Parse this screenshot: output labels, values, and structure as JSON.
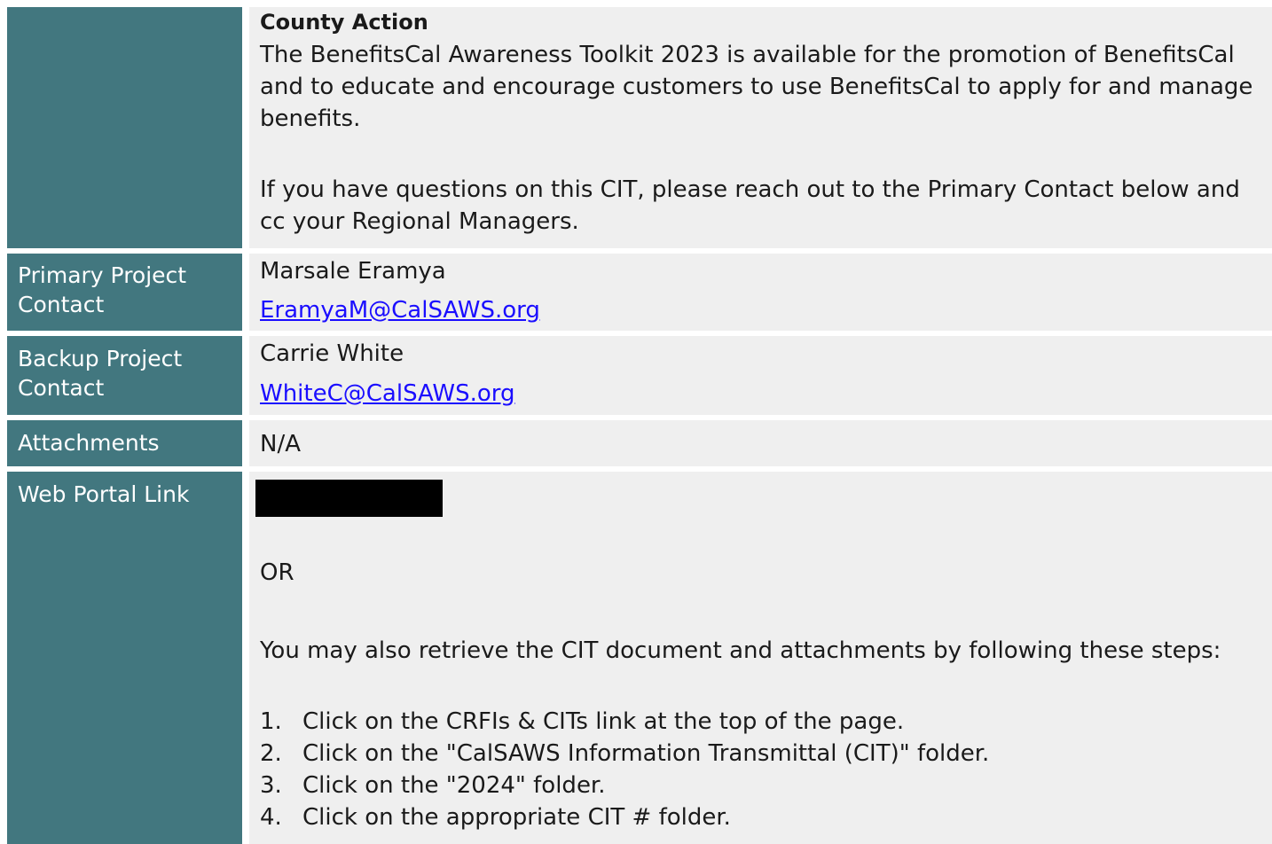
{
  "county_action": {
    "label": "",
    "heading": "County Action",
    "paragraph1": "The BenefitsCal Awareness Toolkit 2023 is available for the promotion of BenefitsCal and to educate and encourage customers to use BenefitsCal to apply for and manage benefits.",
    "paragraph2": "If you have questions on this CIT, please reach out to the Primary Contact below and cc your Regional Managers."
  },
  "primary_contact": {
    "label": "Primary Project Contact",
    "name": "Marsale Eramya",
    "email": "EramyaM@CalSAWS.org"
  },
  "backup_contact": {
    "label": "Backup Project Contact",
    "name": "Carrie White",
    "email": "WhiteC@CalSAWS.org"
  },
  "attachments": {
    "label": "Attachments",
    "value": "N/A"
  },
  "web_portal": {
    "label": "Web Portal Link",
    "or_text": "OR",
    "intro": "You may also retrieve the CIT document and attachments by following these steps:",
    "steps": [
      {
        "num": "1.",
        "text": "Click on the CRFIs & CITs link at the top of the page."
      },
      {
        "num": "2.",
        "text": "Click on the \"CalSAWS Information Transmittal (CIT)\" folder."
      },
      {
        "num": "3.",
        "text": "Click on the \"2024\" folder."
      },
      {
        "num": "4.",
        "text": "Click on the appropriate CIT # folder."
      }
    ]
  },
  "colors": {
    "label_bg": "#42777f",
    "value_bg": "#efefef",
    "link": "#1a0dff"
  }
}
